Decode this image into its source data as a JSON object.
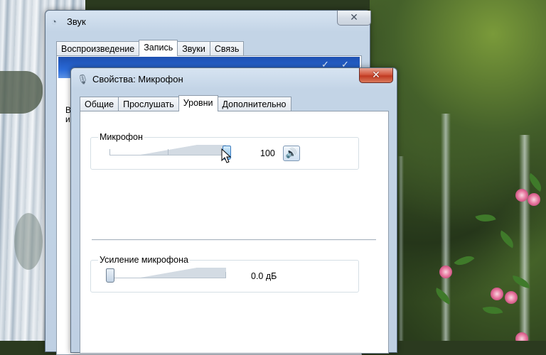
{
  "sound_window": {
    "title": "Звук",
    "tabs": [
      "Воспроизведение",
      "Запись",
      "Звуки",
      "Связь"
    ],
    "active_tab_index": 1,
    "close_glyph": "✕",
    "side_text_fragment": "В\nи"
  },
  "mic_window": {
    "title": "Свойства: Микрофон",
    "close_glyph": "✕",
    "tabs": [
      "Общие",
      "Прослушать",
      "Уровни",
      "Дополнительно"
    ],
    "active_tab_index": 2,
    "microphone": {
      "label": "Микрофон",
      "value": "100",
      "level_percent": 100
    },
    "boost": {
      "label": "Усиление микрофона",
      "value": "0.0 дБ",
      "level_percent": 0
    }
  },
  "icons": {
    "sound_window_icon": "speaker-icon",
    "mic_window_icon": "microphone-icon",
    "mute_toggle": "speaker-volume-icon",
    "pointer": "mouse-cursor-icon"
  },
  "colors": {
    "close_button_red": "#c13a22",
    "window_frame": "#c3d4e6",
    "banner_blue": "#2a6ad8"
  }
}
